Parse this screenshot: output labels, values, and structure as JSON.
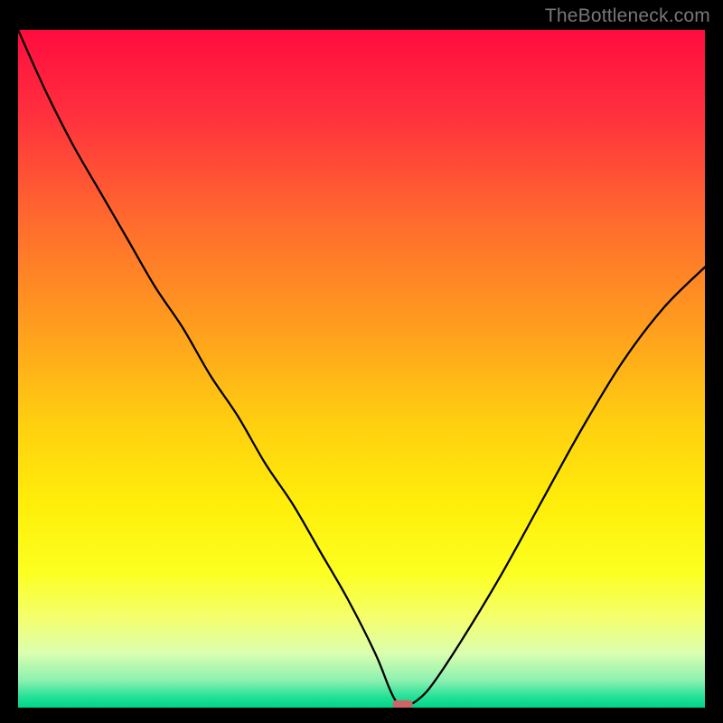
{
  "watermark": "TheBottleneck.com",
  "chart_data": {
    "type": "line",
    "title": "",
    "xlabel": "",
    "ylabel": "",
    "xlim": [
      0,
      100
    ],
    "ylim": [
      0,
      100
    ],
    "x": [
      0,
      4,
      8,
      12,
      16,
      20,
      24,
      28,
      32,
      36,
      40,
      44,
      48,
      52,
      54,
      55,
      56,
      57,
      58,
      60,
      64,
      70,
      76,
      82,
      88,
      94,
      100
    ],
    "values": [
      100,
      91,
      83,
      76,
      69,
      62,
      56,
      49,
      43,
      36,
      30,
      23,
      16,
      8,
      3,
      1,
      0.5,
      0.5,
      1,
      3,
      9,
      19,
      30,
      41,
      51,
      59,
      65
    ],
    "series_name": "bottleneck-curve",
    "marker": {
      "x": 56,
      "y": 0.5,
      "color": "#cc6666"
    },
    "background_gradient": {
      "stops": [
        {
          "offset": 0.0,
          "color": "#ff0c3e"
        },
        {
          "offset": 0.12,
          "color": "#ff2e3e"
        },
        {
          "offset": 0.28,
          "color": "#ff6a2e"
        },
        {
          "offset": 0.44,
          "color": "#ff9e1e"
        },
        {
          "offset": 0.58,
          "color": "#ffcf10"
        },
        {
          "offset": 0.7,
          "color": "#ffee0a"
        },
        {
          "offset": 0.8,
          "color": "#fcff20"
        },
        {
          "offset": 0.87,
          "color": "#f4ff70"
        },
        {
          "offset": 0.92,
          "color": "#daffb0"
        },
        {
          "offset": 0.96,
          "color": "#8cf0b0"
        },
        {
          "offset": 0.985,
          "color": "#20e096"
        },
        {
          "offset": 1.0,
          "color": "#00d488"
        }
      ]
    }
  }
}
